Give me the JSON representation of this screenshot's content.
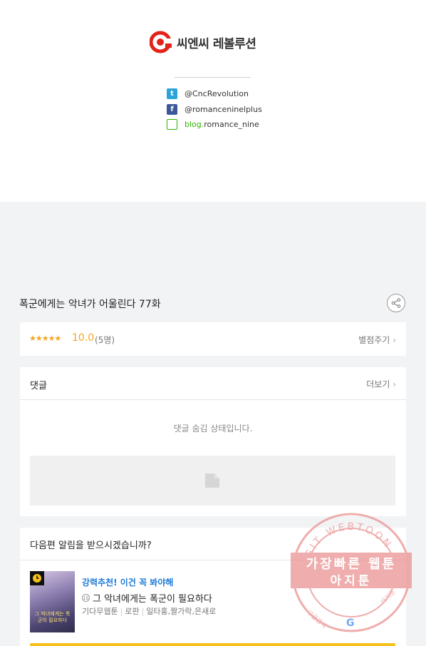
{
  "brand": {
    "name": "씨엔씨 레볼루션"
  },
  "social": [
    {
      "icon": "twitter-icon",
      "text": "@CncRevolution"
    },
    {
      "icon": "facebook-icon",
      "text": "@romanceninelplus"
    },
    {
      "icon": "blog-icon",
      "prefix": "blog.",
      "text": "romance_nine"
    }
  ],
  "episode": {
    "title": "폭군에게는 악녀가 어울린다 77화"
  },
  "rating": {
    "stars": "★★★★★",
    "score": "10.0",
    "votes": "(5명)",
    "rate_label": "별점주기"
  },
  "comments": {
    "label": "댓글",
    "more_label": "더보기",
    "hidden_text": "댓글 숨김 상태입니다."
  },
  "notify": {
    "question": "다음편 알림을 받으시겠습니까?",
    "recommend": "강력추천! 이건 꼭 봐야해",
    "age": "15",
    "work_title": "그 악녀에게는 폭군이 필요하다",
    "meta": [
      "기다무웹툰",
      "로판",
      "일타홍,짤가락,은새로"
    ],
    "thumb_text": "그 악녀에게는 폭군이 필요하다"
  },
  "watermark": {
    "line1": "가장빠른 웹툰",
    "line2": "아지툰",
    "ring": "AGIT WEBTOON",
    "bottom_left": "구글검색",
    "bottom_right": "아지툰"
  },
  "colors": {
    "accent": "#f5a623",
    "link": "#1f7ad6",
    "brand_red": "#e2231a",
    "yellow": "#f7c11b"
  }
}
